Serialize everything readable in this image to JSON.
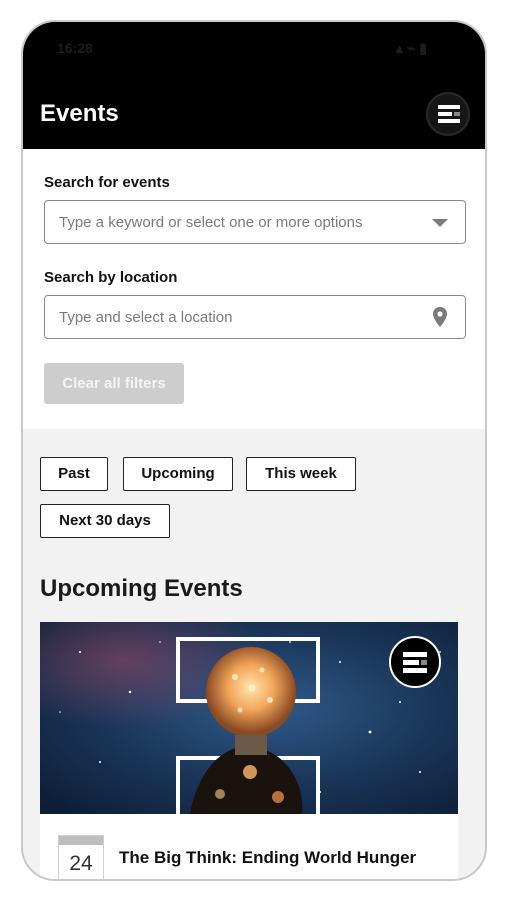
{
  "status_bar": {
    "time": "16:28",
    "icons": "▴ ⌁ ▮"
  },
  "header": {
    "title": "Events",
    "menu_icon": "menu-icon"
  },
  "search": {
    "keyword_label": "Search for events",
    "keyword_placeholder": "Type a keyword or select one or more options",
    "location_label": "Search by location",
    "location_placeholder": "Type and select a location",
    "clear_label": "Clear all filters"
  },
  "filters": [
    {
      "label": "Past"
    },
    {
      "label": "Upcoming"
    },
    {
      "label": "This week"
    },
    {
      "label": "Next 30 days"
    }
  ],
  "section": {
    "title": "Upcoming Events"
  },
  "events": [
    {
      "day": "24",
      "title": "The Big Think: Ending World Hunger",
      "image": "lightbulb-in-hand-starry-sky"
    }
  ],
  "colors": {
    "header_bg": "#000000",
    "page_bg": "#f2f2f2",
    "button_disabled": "#cdcdcd"
  }
}
